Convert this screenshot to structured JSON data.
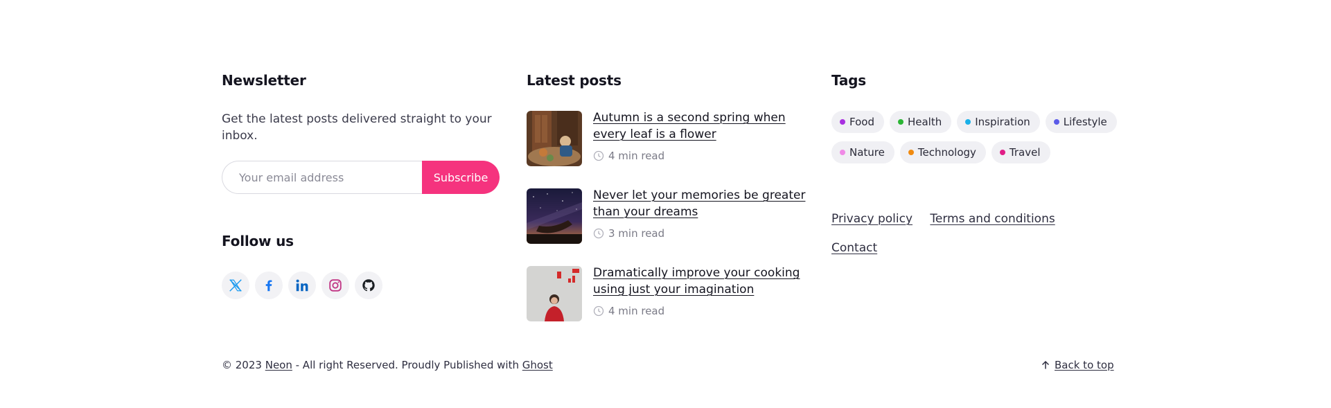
{
  "newsletter": {
    "heading": "Newsletter",
    "description": "Get the latest posts delivered straight to your inbox.",
    "email_placeholder": "Your email address",
    "subscribe_label": "Subscribe"
  },
  "follow": {
    "heading": "Follow us",
    "networks": [
      {
        "name": "x-icon",
        "color": "#1d9bf0"
      },
      {
        "name": "facebook-icon",
        "color": "#1877f2"
      },
      {
        "name": "linkedin-icon",
        "color": "#0a66c2"
      },
      {
        "name": "instagram-icon",
        "color": "#c13584"
      },
      {
        "name": "github-icon",
        "color": "#1b1f23"
      }
    ]
  },
  "latest_posts": {
    "heading": "Latest posts",
    "posts": [
      {
        "title": "Autumn is a second spring when every leaf is a flower",
        "read_time": "4 min read"
      },
      {
        "title": "Never let your memories be greater than your dreams",
        "read_time": "3 min read"
      },
      {
        "title": "Dramatically improve your cooking using just your imagination",
        "read_time": "4 min read"
      }
    ]
  },
  "tags": {
    "heading": "Tags",
    "items": [
      {
        "label": "Food",
        "color": "#a830e0"
      },
      {
        "label": "Health",
        "color": "#2bb534"
      },
      {
        "label": "Inspiration",
        "color": "#1ab0e8"
      },
      {
        "label": "Lifestyle",
        "color": "#5b5be8"
      },
      {
        "label": "Nature",
        "color": "#f08ae6"
      },
      {
        "label": "Technology",
        "color": "#f08a10"
      },
      {
        "label": "Travel",
        "color": "#e01e86"
      }
    ]
  },
  "links": {
    "privacy": "Privacy policy",
    "terms": "Terms and conditions",
    "contact": "Contact"
  },
  "footer": {
    "copyright_prefix": "© 2023 ",
    "site_name": "Neon",
    "rights_text": " - All right Reserved. Proudly Published with ",
    "platform": "Ghost",
    "back_to_top": "Back to top"
  },
  "colors": {
    "accent": "#f5337e",
    "text": "#14141f",
    "muted": "#7a7a86",
    "tag_bg": "#f0f0f4"
  }
}
